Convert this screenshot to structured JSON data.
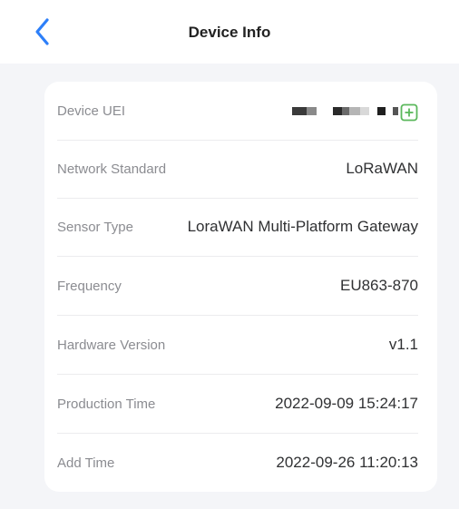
{
  "header": {
    "back_icon": "chevron-left-icon",
    "title": "Device Info"
  },
  "colors": {
    "accent": "#2d7ff9",
    "add_icon": "#5bb85c",
    "background": "#f4f5f8"
  },
  "rows": [
    {
      "label": "Device UEI",
      "value": ""
    },
    {
      "label": "Network Standard",
      "value": "LoRaWAN"
    },
    {
      "label": "Sensor Type",
      "value": "LoraWAN Multi-Platform Gateway"
    },
    {
      "label": "Frequency",
      "value": "EU863-870"
    },
    {
      "label": "Hardware Version",
      "value": "v1.1"
    },
    {
      "label": "Production Time",
      "value": "2022-09-09 15:24:17"
    },
    {
      "label": "Add Time",
      "value": "2022-09-26 11:20:13"
    }
  ],
  "icons": {
    "copy_add": "add-square-icon"
  }
}
